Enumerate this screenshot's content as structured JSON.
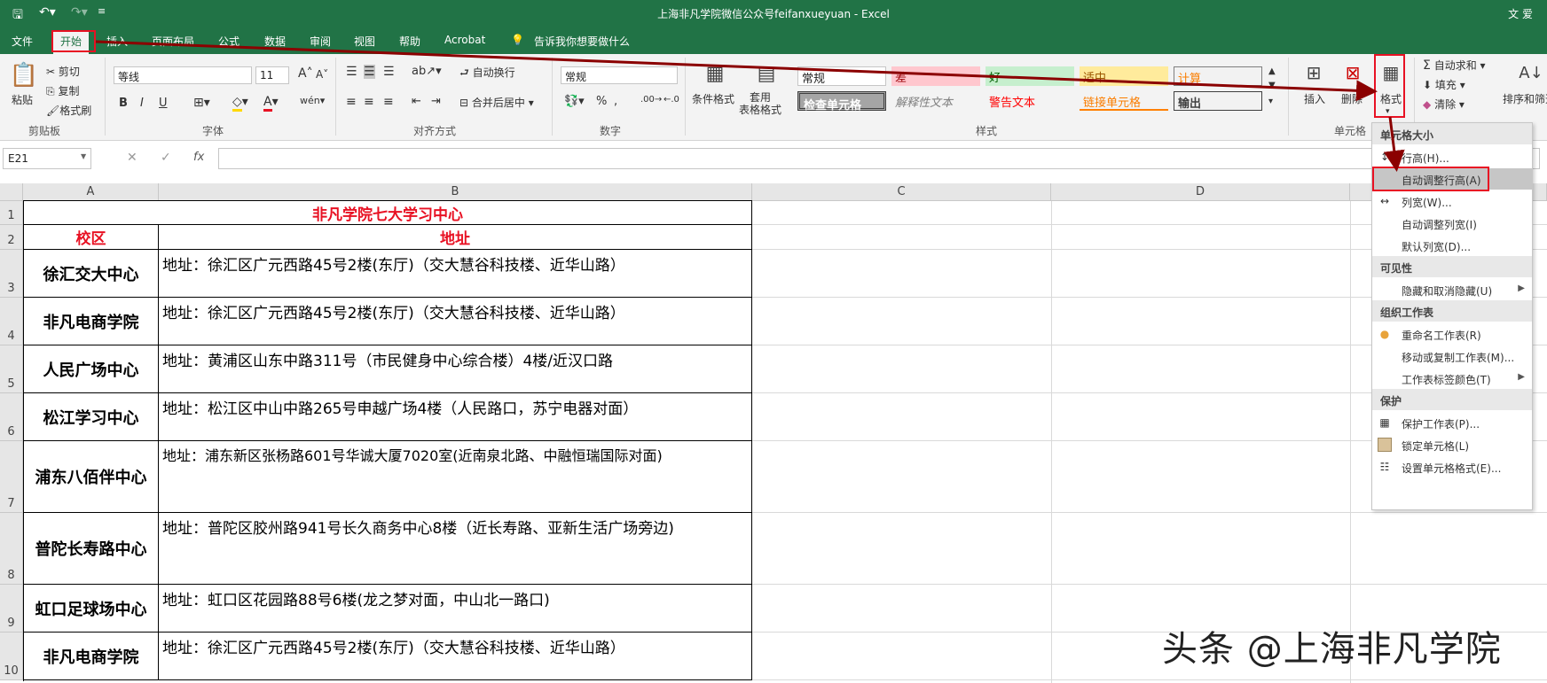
{
  "window": {
    "title": "上海非凡学院微信公众号feifanxueyuan  -  Excel",
    "user": "文 爱"
  },
  "tabs": [
    "文件",
    "开始",
    "插入",
    "页面布局",
    "公式",
    "数据",
    "审阅",
    "视图",
    "帮助",
    "Acrobat"
  ],
  "tell_me": "告诉我你想要做什么",
  "ribbon": {
    "clipboard": {
      "paste": "粘贴",
      "cut": "剪切",
      "copy": "复制",
      "format_painter": "格式刷",
      "label": "剪贴板"
    },
    "font": {
      "name": "等线",
      "size": "11",
      "label": "字体",
      "bold": "B",
      "italic": "I",
      "underline": "U"
    },
    "alignment": {
      "wrap": "自动换行",
      "merge": "合并后居中",
      "label": "对齐方式"
    },
    "number": {
      "format": "常规",
      "label": "数字"
    },
    "styles": {
      "conditional": "条件格式",
      "table": "套用\n表格格式",
      "label": "样式",
      "row1": [
        "常规",
        "差",
        "好",
        "适中",
        "计算"
      ],
      "row2": [
        "检查单元格",
        "解释性文本",
        "警告文本",
        "链接单元格",
        "输出"
      ]
    },
    "cells": {
      "insert": "插入",
      "delete": "删除",
      "format": "格式",
      "label": "单元格"
    },
    "editing": {
      "autosum": "自动求和",
      "fill": "填充",
      "clear": "清除",
      "sort": "排序和筛选"
    }
  },
  "formula_bar": {
    "name_box": "E21",
    "fx": "fx"
  },
  "columns": [
    "A",
    "B",
    "C",
    "D"
  ],
  "rows": [
    "1",
    "2",
    "3",
    "4",
    "5",
    "6",
    "7",
    "8",
    "9",
    "10"
  ],
  "sheet": {
    "title": "非凡学院七大学习中心",
    "header_campus": "校区",
    "header_address": "地址",
    "entries": [
      {
        "campus": "徐汇交大中心",
        "address": "地址：徐汇区广元西路45号2楼(东厅)（交大慧谷科技楼、近华山路）"
      },
      {
        "campus": "非凡电商学院",
        "address": "地址：徐汇区广元西路45号2楼(东厅)（交大慧谷科技楼、近华山路）"
      },
      {
        "campus": "人民广场中心",
        "address": "地址：黄浦区山东中路311号（市民健身中心综合楼）4楼/近汉口路"
      },
      {
        "campus": "松江学习中心",
        "address": "地址：松江区中山中路265号申越广场4楼（人民路口，苏宁电器对面）"
      },
      {
        "campus": "浦东八佰伴中心",
        "address": "地址：浦东新区张杨路601号华诚大厦7020室(近南泉北路、中融恒瑞国际对面)"
      },
      {
        "campus": "普陀长寿路中心",
        "address": "地址：普陀区胶州路941号长久商务中心8楼（近长寿路、亚新生活广场旁边)"
      },
      {
        "campus": "虹口足球场中心",
        "address": "地址：虹口区花园路88号6楼(龙之梦对面，中山北一路口)"
      },
      {
        "campus": "非凡电商学院",
        "address": "地址：徐汇区广元西路45号2楼(东厅)（交大慧谷科技楼、近华山路）"
      }
    ]
  },
  "format_menu": {
    "sections": {
      "cell_size": "单元格大小",
      "visibility": "可见性",
      "organize": "组织工作表",
      "protection": "保护"
    },
    "items": {
      "row_height": "行高(H)...",
      "autofit_row": "自动调整行高(A)",
      "col_width": "列宽(W)...",
      "autofit_col": "自动调整列宽(I)",
      "default_width": "默认列宽(D)...",
      "hide_unhide": "隐藏和取消隐藏(U)",
      "rename": "重命名工作表(R)",
      "move_copy": "移动或复制工作表(M)...",
      "tab_color": "工作表标签颜色(T)",
      "protect": "保护工作表(P)...",
      "lock": "锁定单元格(L)",
      "format_cells": "设置单元格格式(E)..."
    }
  },
  "watermark": "头条 @上海非凡学院",
  "colors": {
    "excel_green": "#217346",
    "highlight_red": "#e81123",
    "arrow": "#8b0000"
  }
}
